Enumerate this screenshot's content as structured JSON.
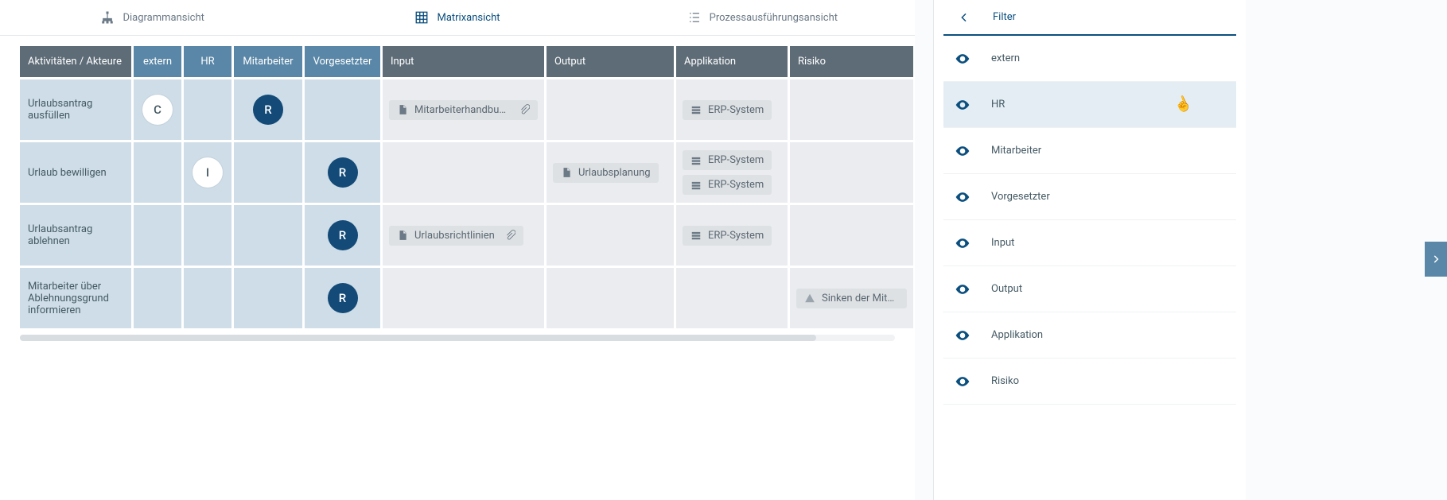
{
  "tabs": {
    "diagram": "Diagrammansicht",
    "matrix": "Matrixansicht",
    "process": "Prozessausführungsansicht"
  },
  "matrix": {
    "header_activities": "Aktivitäten / Akteure",
    "actors": [
      "extern",
      "HR",
      "Mitarbeiter",
      "Vorgesetzter"
    ],
    "cols": [
      "Input",
      "Output",
      "Applikation",
      "Risiko"
    ],
    "rows": [
      {
        "activity": "Urlaubsantrag ausfüllen",
        "raci": [
          "C",
          "",
          "R",
          ""
        ],
        "input": [
          {
            "label": "Mitarbeiterhandbuch",
            "attach": true
          }
        ],
        "output": [],
        "app": [
          {
            "label": "ERP-System"
          }
        ],
        "risk": []
      },
      {
        "activity": "Urlaub bewilligen",
        "raci": [
          "",
          "I",
          "",
          "R"
        ],
        "input": [],
        "output": [
          {
            "label": "Urlaubsplanung"
          }
        ],
        "app": [
          {
            "label": "ERP-System"
          },
          {
            "label": "ERP-System"
          }
        ],
        "risk": []
      },
      {
        "activity": "Urlaubsantrag ablehnen",
        "raci": [
          "",
          "",
          "",
          "R"
        ],
        "input": [
          {
            "label": "Urlaubsrichtlinien",
            "attach": true
          }
        ],
        "output": [],
        "app": [
          {
            "label": "ERP-System"
          }
        ],
        "risk": []
      },
      {
        "activity": "Mitarbeiter über Ablehnungsgrund informieren",
        "raci": [
          "",
          "",
          "",
          "R"
        ],
        "input": [],
        "output": [],
        "app": [],
        "risk": [
          {
            "label": "Sinken der Mitarbeit"
          }
        ]
      }
    ]
  },
  "filter": {
    "title": "Filter",
    "items": [
      "extern",
      "HR",
      "Mitarbeiter",
      "Vorgesetzter",
      "Input",
      "Output",
      "Applikation",
      "Risiko"
    ],
    "hover_index": 1
  }
}
